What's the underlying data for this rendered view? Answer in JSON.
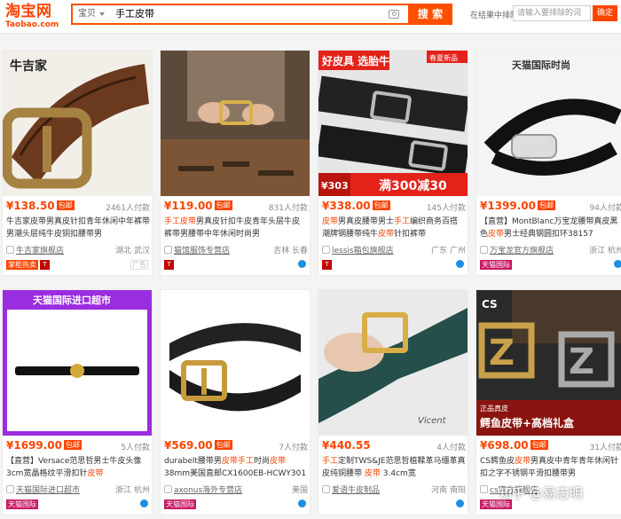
{
  "logo": {
    "cn": "淘宝网",
    "en": "Taobao.com"
  },
  "search": {
    "type": "宝贝",
    "query": "手工皮带",
    "button": "搜 索"
  },
  "in_result": {
    "label": "在结果中排除",
    "placeholder": "请输入要排除的词",
    "button": "确定"
  },
  "products": [
    {
      "price": "¥138.50",
      "free_ship": "包邮",
      "buyers": "2461人付款",
      "title_parts": [
        {
          "t": "牛吉家皮带男真皮针扣青年休闲中年裤带男潮头层纯牛皮铜扣腰带男",
          "h": false
        }
      ],
      "shop": "牛吉家旗舰店",
      "location": "湖北 武汉",
      "badge": "掌柜热卖",
      "badge_type": "red",
      "tmall": true,
      "extra": "ad",
      "ad": "广告",
      "image": {
        "overlay": "牛吉家"
      }
    },
    {
      "price": "¥119.00",
      "free_ship": "包邮",
      "buyers": "831人付款",
      "title_parts": [
        {
          "t": "手工皮带",
          "h": true
        },
        {
          "t": "男真皮针扣牛皮青年头层牛皮裤带男腰带中年休闲时尚男",
          "h": false
        }
      ],
      "shop": "猫馆服饰专营店",
      "location": "吉林 长春",
      "badge": "",
      "badge_type": "",
      "tmall": true,
      "extra": "ww",
      "image": {
        "overlay": ""
      }
    },
    {
      "price": "¥338.00",
      "free_ship": "包邮",
      "buyers": "145人付款",
      "title_parts": [
        {
          "t": "皮带",
          "h": true
        },
        {
          "t": "男真皮腰带男士",
          "h": false
        },
        {
          "t": "手工",
          "h": true
        },
        {
          "t": "编织商务百搭潮牌钢腰带纯牛",
          "h": false
        },
        {
          "t": "皮带",
          "h": true
        },
        {
          "t": "针扣裤带",
          "h": false
        }
      ],
      "shop": "lessis箱包旗舰店",
      "location": "广东 广州",
      "badge": "",
      "badge_type": "",
      "tmall": true,
      "extra": "ww",
      "image": {
        "overlay": "好皮具 选胎牛",
        "tag": "春夏新品",
        "promo_price": "¥303",
        "promo": "满300减30"
      }
    },
    {
      "price": "¥1399.00",
      "free_ship": "包邮",
      "buyers": "94人付款",
      "title_parts": [
        {
          "t": "【直营】MontBlanc万宝龙腰带真皮黑色",
          "h": false
        },
        {
          "t": "皮带",
          "h": true
        },
        {
          "t": "男士经典钢圆扣环38157",
          "h": false
        }
      ],
      "shop": "万宝龙官方旗舰店",
      "location": "浙江 杭州",
      "badge": "天猫国际",
      "badge_type": "pink",
      "tmall": false,
      "extra": "ww",
      "image": {
        "overlay": "天猫国际时尚"
      }
    },
    {
      "price": "¥1699.00",
      "free_ship": "包邮",
      "buyers": "5人付款",
      "title_parts": [
        {
          "t": "【直营】Versace范思哲男士牛皮头像3cm宽晶格纹平滑扣针",
          "h": false
        },
        {
          "t": "皮带",
          "h": true
        }
      ],
      "shop": "天猫国际进口超市",
      "location": "浙江 杭州",
      "badge": "天猫国际",
      "badge_type": "pink",
      "tmall": false,
      "extra": "ww",
      "image": {
        "overlay": "天猫国际进口超市"
      }
    },
    {
      "price": "¥569.00",
      "free_ship": "包邮",
      "buyers": "7人付款",
      "title_parts": [
        {
          "t": "durabelt腰带男",
          "h": false
        },
        {
          "t": "皮带手工",
          "h": true
        },
        {
          "t": "时尚",
          "h": false
        },
        {
          "t": "皮带",
          "h": true
        },
        {
          "t": "38mm美国直邮CX1600EB-HCWY301",
          "h": false
        }
      ],
      "shop": "axonus海外专营店",
      "location": "美国",
      "badge": "天猫国际",
      "badge_type": "pink",
      "tmall": false,
      "extra": "ww",
      "image": {
        "overlay": ""
      }
    },
    {
      "price": "¥440.55",
      "free_ship": "",
      "buyers": "4人付款",
      "title_parts": [
        {
          "t": "手工",
          "h": true
        },
        {
          "t": "定制TWS&JE范思哲植鞣革马缰革真皮纯铜腰带 ",
          "h": false
        },
        {
          "t": "皮带",
          "h": true
        },
        {
          "t": " 3.4cm宽",
          "h": false
        }
      ],
      "shop": "爱语牛皮制品",
      "location": "河南 南阳",
      "badge": "",
      "badge_type": "",
      "tmall": false,
      "extra": "ww",
      "image": {
        "overlay": "Vicent"
      }
    },
    {
      "price": "¥698.00",
      "free_ship": "包邮",
      "buyers": "31人付款",
      "title_parts": [
        {
          "t": "CS鳄鱼皮",
          "h": false
        },
        {
          "t": "皮带",
          "h": true
        },
        {
          "t": "男真皮中青年青年休闲针扣之字不锈钢平滑扣腰带男",
          "h": false
        }
      ],
      "shop": "cs官方旗舰店",
      "location": "",
      "badge": "天猫国际",
      "badge_type": "pink",
      "tmall": false,
      "extra": "ww",
      "image": {
        "overlay": "鳄鱼皮带+高档礼盒",
        "tag": "正品真皮",
        "brand": "CS"
      }
    }
  ],
  "watermark": "知乎 @易志明"
}
